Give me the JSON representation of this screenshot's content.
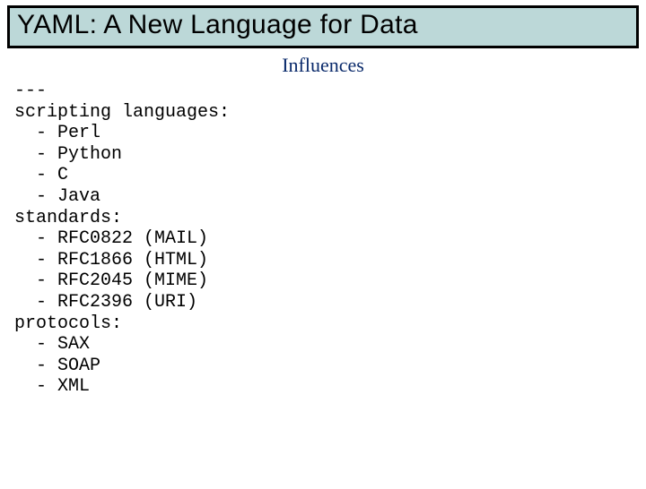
{
  "title": "YAML: A New Language for Data",
  "subtitle": "Influences",
  "yaml": "---\nscripting languages:\n  - Perl\n  - Python\n  - C\n  - Java\nstandards:\n  - RFC0822 (MAIL)\n  - RFC1866 (HTML)\n  - RFC2045 (MIME)\n  - RFC2396 (URI)\nprotocols:\n  - SAX\n  - SOAP\n  - XML"
}
